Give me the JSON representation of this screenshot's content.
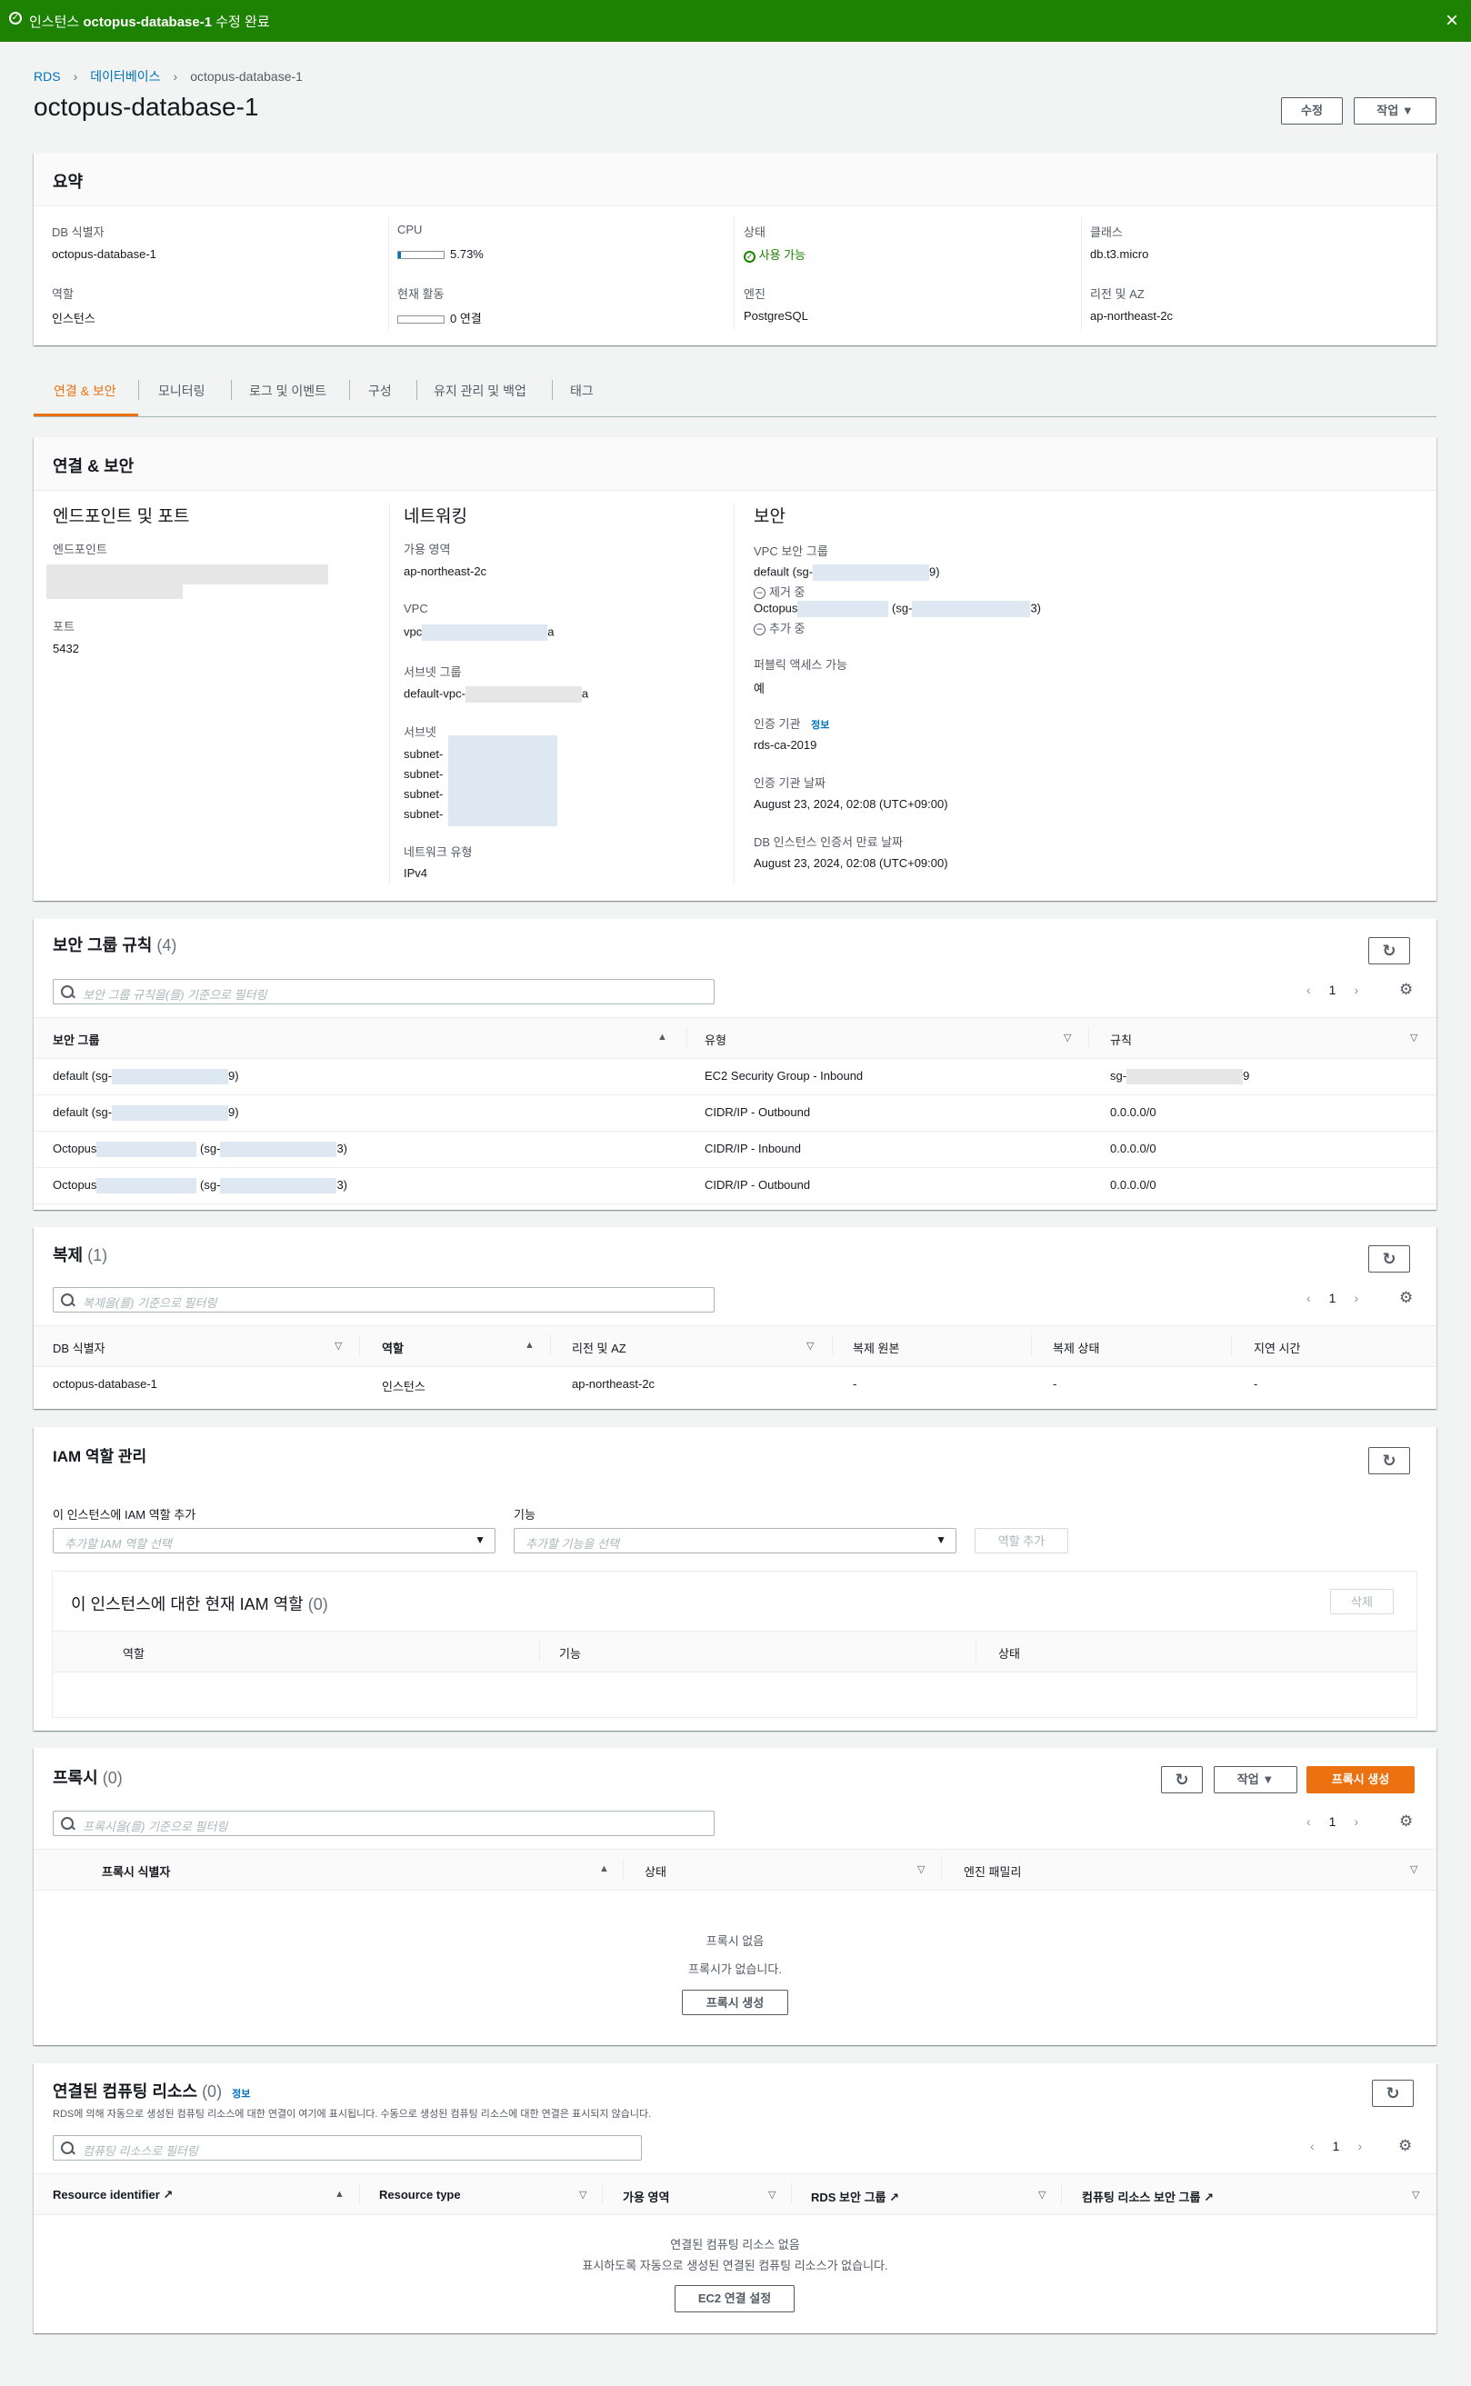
{
  "flash": {
    "prefix": "인스턴스",
    "name": "octopus-database-1",
    "suffix": "수정 완료"
  },
  "breadcrumb": {
    "rds": "RDS",
    "db": "데이터베이스",
    "current": "octopus-database-1"
  },
  "page_title": "octopus-database-1",
  "header_buttons": {
    "modify": "수정",
    "actions": "작업"
  },
  "summary": {
    "title": "요약",
    "db_id_label": "DB 식별자",
    "db_id": "octopus-database-1",
    "role_label": "역할",
    "role": "인스턴스",
    "cpu_label": "CPU",
    "cpu": "5.73%",
    "cpu_fraction": 0.0573,
    "activity_label": "현재 활동",
    "activity": "0 연결",
    "status_label": "상태",
    "status": "사용 가능",
    "engine_label": "엔진",
    "engine": "PostgreSQL",
    "class_label": "클래스",
    "class": "db.t3.micro",
    "region_label": "리전 및 AZ",
    "region": "ap-northeast-2c",
    "status_color": "#1d8102"
  },
  "tabs": [
    "연결 & 보안",
    "모니터링",
    "로그 및 이벤트",
    "구성",
    "유지 관리 및 백업",
    "태그"
  ],
  "conn": {
    "title": "연결 & 보안",
    "endpoint_head": "엔드포인트 및 포트",
    "endpoint_label": "엔드포인트",
    "port_label": "포트",
    "port": "5432",
    "network_head": "네트워킹",
    "az_label": "가용 영역",
    "az": "ap-northeast-2c",
    "vpc_label": "VPC",
    "vpc_pre": "vpc",
    "vpc_suf": "a",
    "subnet_group_label": "서브넷 그룹",
    "subnet_group_pre": "default-vpc-",
    "subnet_group_suf": "a",
    "subnets_label": "서브넷",
    "subnet_pre": "subnet-",
    "network_type_label": "네트워크 유형",
    "network_type": "IPv4",
    "security_head": "보안",
    "vpc_sg_label": "VPC 보안 그룹",
    "sg1_pre": "default (sg-",
    "sg1_suf": "9)",
    "sg1_state": "제거 중",
    "sg2_pre": "Octopus",
    "sg2_mid": "(sg-",
    "sg2_suf": "3)",
    "sg2_state": "추가 중",
    "public_label": "퍼블릭 액세스 가능",
    "public": "예",
    "ca_label": "인증 기관",
    "ca_info": "정보",
    "ca": "rds-ca-2019",
    "ca_date_label": "인증 기관 날짜",
    "ca_date": "August 23, 2024, 02:08 (UTC+09:00)",
    "cert_exp_label": "DB 인스턴스 인증서 만료 날짜",
    "cert_exp": "August 23, 2024, 02:08 (UTC+09:00)"
  },
  "sg_rules": {
    "title": "보안 그룹 규칙",
    "count": "(4)",
    "search_placeholder": "보안 그룹 규칙을(를) 기준으로 필터링",
    "page": "1",
    "cols": [
      "보안 그룹",
      "유형",
      "규칙"
    ],
    "rows": [
      {
        "g_pre": "default (sg-",
        "g_mid": "",
        "g_suf": "9)",
        "type": "EC2 Security Group - Inbound",
        "rule_pre": "sg-",
        "rule_suf": "9"
      },
      {
        "g_pre": "default (sg-",
        "g_mid": "",
        "g_suf": "9)",
        "type": "CIDR/IP - Outbound",
        "rule": "0.0.0.0/0"
      },
      {
        "g_pre": "Octopus",
        "g_mid": "(sg-",
        "g_suf": "3)",
        "type": "CIDR/IP - Inbound",
        "rule": "0.0.0.0/0"
      },
      {
        "g_pre": "Octopus",
        "g_mid": "(sg-",
        "g_suf": "3)",
        "type": "CIDR/IP - Outbound",
        "rule": "0.0.0.0/0"
      }
    ]
  },
  "replication": {
    "title": "복제",
    "count": "(1)",
    "search_placeholder": "복제을(를) 기준으로 필터링",
    "page": "1",
    "cols": [
      "DB 식별자",
      "역할",
      "리전 및 AZ",
      "복제 원본",
      "복제 상태",
      "지연 시간"
    ],
    "row": {
      "id": "octopus-database-1",
      "role": "인스턴스",
      "region": "ap-northeast-2c",
      "source": "-",
      "state": "-",
      "lag": "-"
    }
  },
  "iam": {
    "title": "IAM 역할 관리",
    "add_label": "이 인스턴스에 IAM 역할 추가",
    "role_placeholder": "추가할 IAM 역할 선택",
    "feature_label": "기능",
    "feature_placeholder": "추가할 기능을 선택",
    "add_button": "역할 추가",
    "current_title": "이 인스턴스에 대한 현재 IAM 역할",
    "current_count": "(0)",
    "delete_button": "삭제",
    "cols": [
      "역할",
      "기능",
      "상태"
    ]
  },
  "proxy": {
    "title": "프록시",
    "count": "(0)",
    "actions": "작업",
    "create": "프록시 생성",
    "search_placeholder": "프록시을(를) 기준으로 필터링",
    "page": "1",
    "cols": [
      "프록시 식별자",
      "상태",
      "엔진 패밀리"
    ],
    "empty_title": "프록시 없음",
    "empty_desc": "프록시가 없습니다.",
    "empty_button": "프록시 생성"
  },
  "compute": {
    "title": "연결된 컴퓨팅 리소스",
    "count": "(0)",
    "info": "정보",
    "desc": "RDS에 의해 자동으로 생성된 컴퓨팅 리소스에 대한 연결이 여기에 표시됩니다. 수동으로 생성된 컴퓨팅 리소스에 대한 연결은 표시되지 않습니다.",
    "search_placeholder": "컴퓨팅 리소스로 필터링",
    "page": "1",
    "cols": [
      "Resource identifier",
      "Resource type",
      "가용 영역",
      "RDS 보안 그룹",
      "컴퓨팅 리소스 보안 그룹"
    ],
    "empty_title": "연결된 컴퓨팅 리소스 없음",
    "empty_desc": "표시하도록 자동으로 생성된 연결된 컴퓨팅 리소스가 없습니다.",
    "empty_button": "EC2 연결 설정"
  }
}
